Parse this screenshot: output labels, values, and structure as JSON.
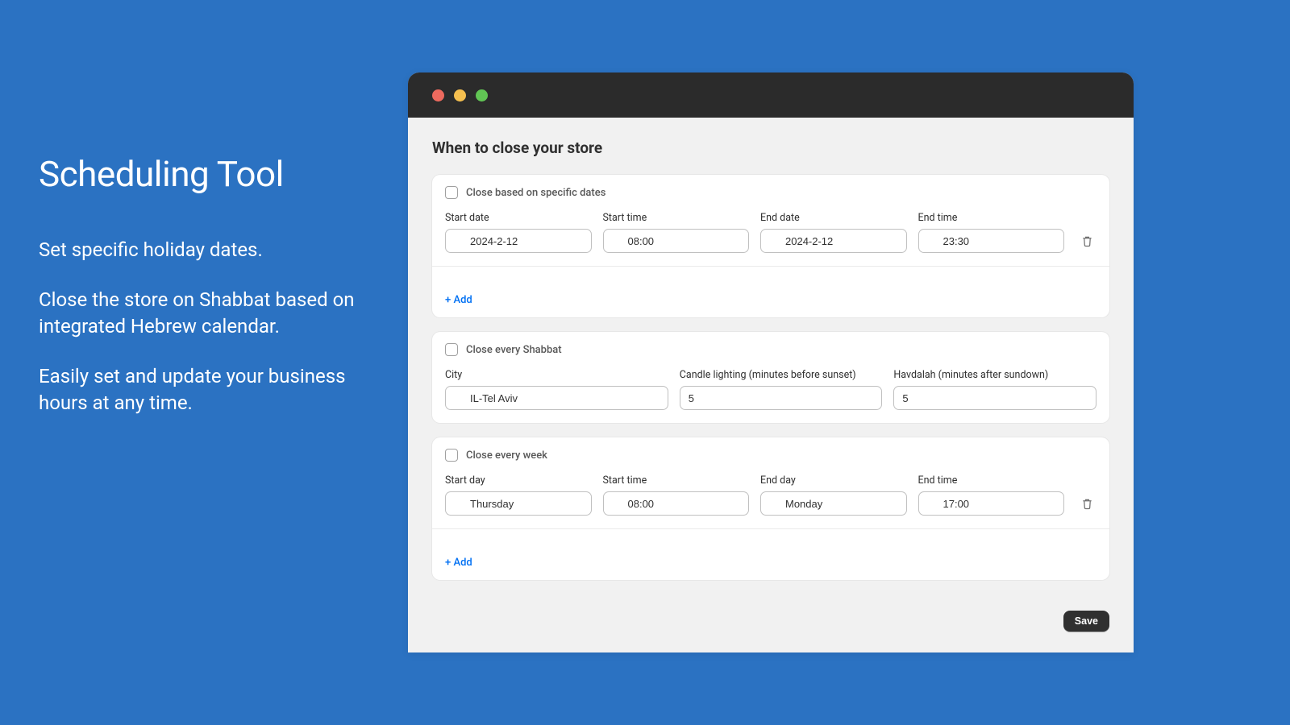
{
  "marketing": {
    "title": "Scheduling Tool",
    "desc1": "Set specific holiday dates.",
    "desc2": "Close the store on Shabbat based on integrated Hebrew calendar.",
    "desc3": "Easily set and update your business hours at any time."
  },
  "page": {
    "title": "When to close your store",
    "save_label": "Save"
  },
  "specific_dates": {
    "checkbox_label": "Close based on specific dates",
    "add_label": "+ Add",
    "fields": {
      "start_date_label": "Start date",
      "start_date_value": "2024-2-12",
      "start_time_label": "Start time",
      "start_time_value": "08:00",
      "end_date_label": "End date",
      "end_date_value": "2024-2-12",
      "end_time_label": "End time",
      "end_time_value": "23:30"
    }
  },
  "shabbat": {
    "checkbox_label": "Close every Shabbat",
    "city_label": "City",
    "city_value": "IL-Tel Aviv",
    "candle_label": "Candle lighting (minutes before sunset)",
    "candle_value": "5",
    "havdalah_label": "Havdalah (minutes after sundown)",
    "havdalah_value": "5"
  },
  "weekly": {
    "checkbox_label": "Close every week",
    "add_label": "+ Add",
    "fields": {
      "start_day_label": "Start day",
      "start_day_value": "Thursday",
      "start_time_label": "Start time",
      "start_time_value": "08:00",
      "end_day_label": "End day",
      "end_day_value": "Monday",
      "end_time_label": "End time",
      "end_time_value": "17:00"
    }
  }
}
